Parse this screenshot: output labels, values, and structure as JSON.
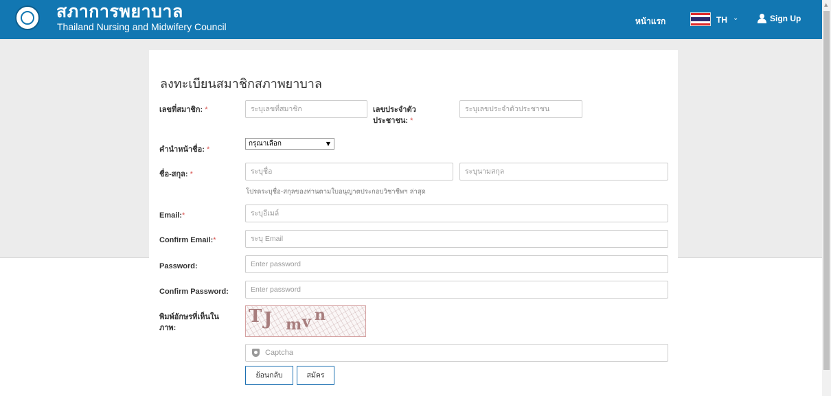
{
  "header": {
    "brand_thai": "สภาการพยาบาล",
    "brand_english": "Thailand Nursing and Midwifery Council",
    "nav_home": "หน้าแรก",
    "language_code": "TH",
    "language_chevron": "⌄",
    "sign_up_label": "Sign Up"
  },
  "form": {
    "title": "ลงทะเบียนสมาชิกสภาพยาบาล",
    "member_no": {
      "label": "เลขที่สมาชิก:",
      "required": "*",
      "placeholder": "ระบุเลขที่สมาชิก"
    },
    "citizen_id": {
      "label_line1": "เลขประจำตัว",
      "label_line2": "ประชาชน:",
      "required": "*",
      "placeholder": "ระบุเลขประจำตัวประชาชน"
    },
    "title_prefix": {
      "label": "คำนำหน้าชื่อ:",
      "required": "*",
      "selected": "กรุณาเลือก",
      "arrow": "▼"
    },
    "full_name": {
      "label": "ชื่อ-สกุล:",
      "required": "*",
      "first_placeholder": "ระบุชื่อ",
      "last_placeholder": "ระบุนามสกุล",
      "hint": "โปรดระบุชื่อ-สกุลของท่านตามใบอนุญาตประกอบวิชาชีพฯ ล่าสุด"
    },
    "email": {
      "label": "Email:",
      "required": "*",
      "placeholder": "ระบุอีเมล์"
    },
    "confirm_email": {
      "label": "Confirm Email:",
      "required": "*",
      "placeholder": "ระบุ Email"
    },
    "password": {
      "label": "Password:",
      "placeholder": "Enter password"
    },
    "confirm_password": {
      "label": "Confirm Password:",
      "placeholder": "Enter password"
    },
    "captcha": {
      "label_line1": "พิมพ์อักษรที่เห็นใน",
      "label_line2": "ภาพ:",
      "chars": [
        "T",
        "J",
        "m",
        "v",
        "n"
      ],
      "placeholder": "Captcha"
    },
    "back_button": "ย้อนกลับ",
    "submit_button": "สมัคร"
  },
  "colors": {
    "navbar": "#1277b2",
    "required": "#d9534f",
    "button_border": "#1a6fb1",
    "page_band": "#ececec"
  }
}
